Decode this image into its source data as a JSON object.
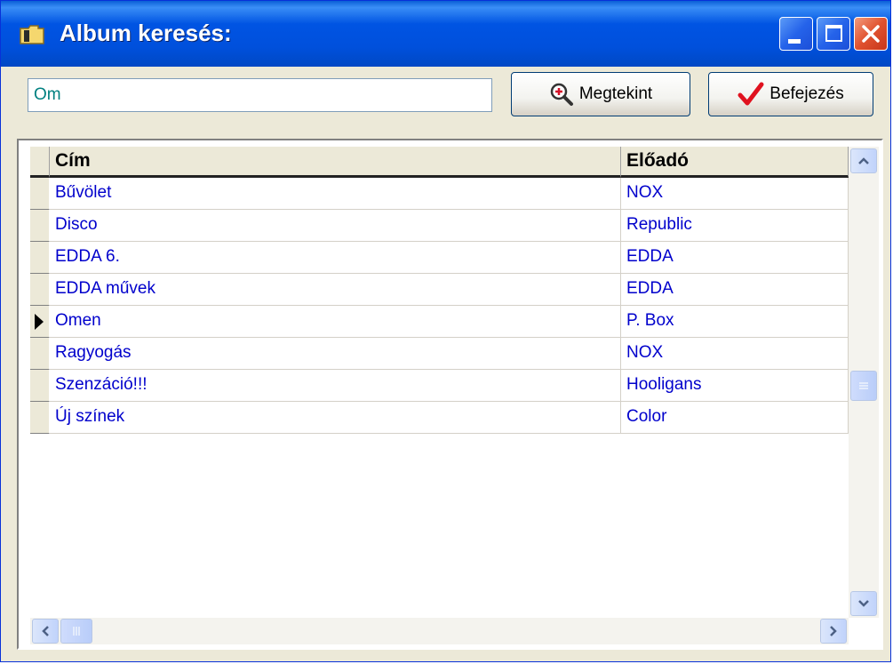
{
  "window": {
    "title": "Album keresés:"
  },
  "search": {
    "value": "Om"
  },
  "buttons": {
    "view_label": "Megtekint",
    "finish_label": "Befejezés"
  },
  "grid": {
    "columns": [
      "Cím",
      "Előadó"
    ],
    "selected_row": 4,
    "rows": [
      {
        "title": "Bűvölet",
        "artist": "NOX"
      },
      {
        "title": "Disco",
        "artist": "Republic"
      },
      {
        "title": "EDDA 6.",
        "artist": "EDDA"
      },
      {
        "title": "EDDA művek",
        "artist": "EDDA"
      },
      {
        "title": "Omen",
        "artist": "P. Box"
      },
      {
        "title": "Ragyogás",
        "artist": "NOX"
      },
      {
        "title": "Szenzáció!!!",
        "artist": "Hooligans"
      },
      {
        "title": "Új színek",
        "artist": "Color"
      }
    ]
  },
  "colors": {
    "cell_text": "#0000cc",
    "title_bar": "#0054e3",
    "search_text": "#008080"
  },
  "icons": {
    "title": "folder-icon",
    "view": "magnifier-plus-icon",
    "finish": "checkmark-icon"
  }
}
